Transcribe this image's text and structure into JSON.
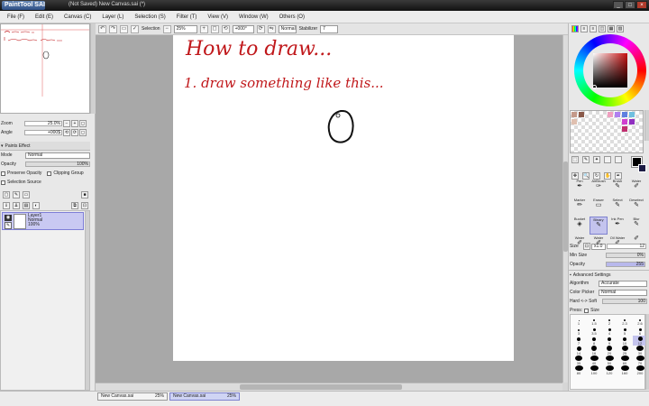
{
  "window": {
    "app_name": "PaintTool SAI",
    "title": "(Not Saved) New Canvas.sai (*)",
    "buttons": [
      "_",
      "□",
      "×"
    ]
  },
  "menu": [
    "File (F)",
    "Edit (E)",
    "Canvas (C)",
    "Layer (L)",
    "Selection (S)",
    "Filter (T)",
    "View (V)",
    "Window (W)",
    "Others (O)"
  ],
  "toolbar": {
    "selection_label": "Selection",
    "zoom": "25%",
    "rotation": "+000°",
    "blend_mode": "Normal",
    "stabilizer_label": "Stabilizer",
    "stabilizer_value": "7"
  },
  "navigator_panel": {
    "zoom_label": "Zoom",
    "zoom_value": "25.0%",
    "angle_label": "Angle",
    "angle_value": "+000$"
  },
  "layer_panel": {
    "effects_header": "Paints Effect",
    "mode_label": "Mode",
    "mode_value": "Normal",
    "opacity_label": "Opacity",
    "opacity_value": "100%",
    "preserve_opacity": "Preserve Opacity",
    "clipping_group": "Clipping Group",
    "selection_source": "Selection Source",
    "layers": [
      {
        "name": "Layer1",
        "mode": "Normal",
        "opacity": "100%"
      }
    ]
  },
  "canvas": {
    "line1": "How to draw...",
    "line2": "1. draw something like this..."
  },
  "documents": [
    {
      "name": "New Canvas.sai",
      "zoom": "25%",
      "active": false
    },
    {
      "name": "New Canvas.sai",
      "zoom": "25%",
      "active": true
    }
  ],
  "tools": [
    [
      "Pen",
      "AirBrush",
      "Brush",
      "Water"
    ],
    [
      "Marker",
      "Eraser",
      "Select",
      "Deselect"
    ],
    [
      "Bucket",
      "Binary",
      "Ink Pen",
      "Blur"
    ],
    [
      "Water",
      "Water",
      "Oil Water",
      ""
    ]
  ],
  "brush": {
    "size_label": "Size",
    "size_multiplier": "x1.0",
    "size_value": "12",
    "min_size_label": "Min Size",
    "min_size_value": "0%",
    "density_label": "Opacity",
    "density_value": "255",
    "advanced_label": "Advanced Settings",
    "algorithm_label": "Algorithm",
    "algorithm_value": "Accurate",
    "color_picker_label": "Color Picker",
    "color_picker_value": "Normal",
    "hard_soft_label": "Hard <-> Soft",
    "hard_soft_value": "100",
    "press_label": "Press:",
    "press_size_label": "Size",
    "dot_sizes": [
      "1",
      "1.5",
      "2",
      "2.3",
      "2.6",
      "3",
      "3.5",
      "4",
      "5",
      "6",
      "7",
      "8",
      "9",
      "10",
      "12",
      "14",
      "16",
      "20",
      "25",
      "30",
      "35",
      "40",
      "50",
      "60",
      "70",
      "80",
      "100",
      "120",
      "160",
      "200"
    ]
  },
  "colors": {
    "accent": "#c4c4ee",
    "current_color": "#000000",
    "ink_red": "#c0171a"
  }
}
